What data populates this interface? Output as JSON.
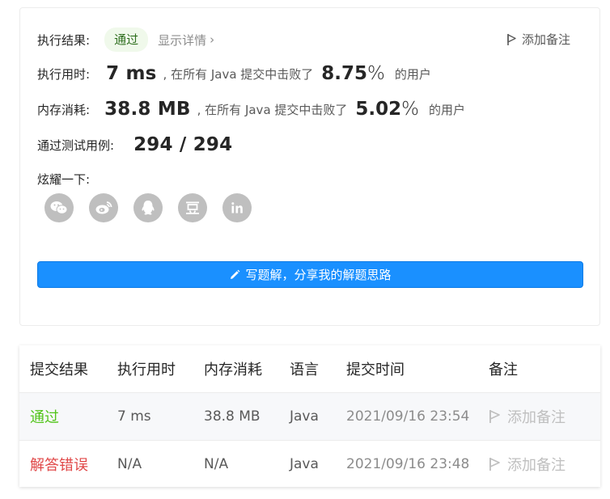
{
  "result": {
    "label": "执行结果:",
    "status": "通过",
    "details_link": "显示详情",
    "add_note": "添加备注"
  },
  "runtime": {
    "label": "执行用时:",
    "value": "7 ms",
    "beat_text": ", 在所有 Java 提交中击败了",
    "percent": "8.75",
    "percent_sign": "%",
    "users": "的用户"
  },
  "memory": {
    "label": "内存消耗:",
    "value": "38.8 MB",
    "beat_text": ", 在所有 Java 提交中击败了",
    "percent": "5.02",
    "percent_sign": "%",
    "users": "的用户"
  },
  "tests": {
    "label": "通过测试用例:",
    "value": "294 / 294"
  },
  "share": {
    "label": "炫耀一下:",
    "icons": [
      "wechat-icon",
      "weibo-icon",
      "qq-icon",
      "douban-icon",
      "linkedin-icon"
    ]
  },
  "cta": {
    "label": "写题解，分享我的解题思路"
  },
  "table": {
    "headers": [
      "提交结果",
      "执行用时",
      "内存消耗",
      "语言",
      "提交时间",
      "备注"
    ],
    "rows": [
      {
        "status": "通过",
        "time": "7 ms",
        "memory": "38.8 MB",
        "lang": "Java",
        "submitted": "2021/09/16 23:54",
        "note": "添加备注"
      },
      {
        "status": "解答错误",
        "time": "N/A",
        "memory": "N/A",
        "lang": "Java",
        "submitted": "2021/09/16 23:48",
        "note": "添加备注"
      }
    ]
  },
  "colors": {
    "accent": "#1a90ff",
    "pass": "#52c41a",
    "fail": "#e04848",
    "icon_bg": "#bfbfbf"
  }
}
